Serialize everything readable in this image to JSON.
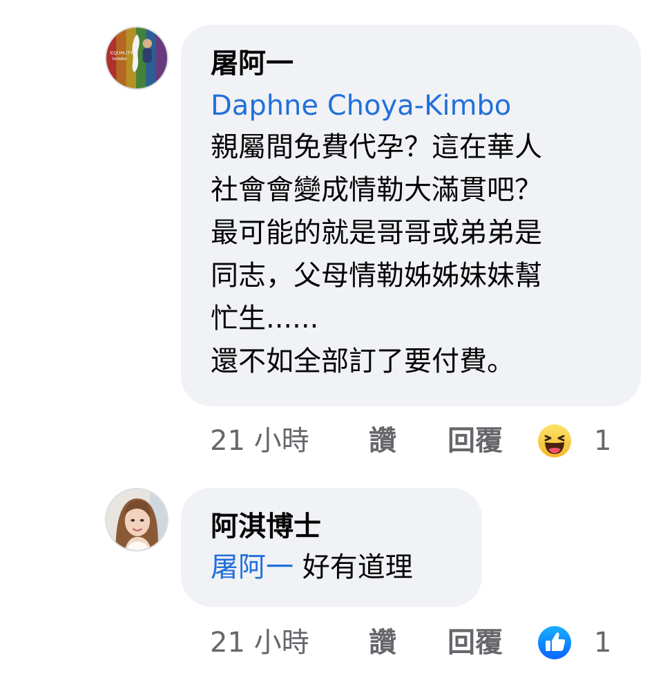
{
  "comments": [
    {
      "author": "屠阿一",
      "mention": "Daphne Choya-Kimbo",
      "lines": [
        "親屬間免費代孕？這在華人",
        "社會會變成情勒大滿貫吧？",
        "最可能的就是哥哥或弟弟是",
        "同志，父母情勒姊姊妹妹幫",
        "忙生......",
        "還不如全部訂了要付費。"
      ],
      "avatar_text": [
        "EQUALITY",
        "TAIWAN"
      ],
      "time": "21 小時",
      "like_label": "讚",
      "reply_label": "回覆",
      "reaction_icon": "haha-emoji-icon",
      "reaction_count": "1"
    },
    {
      "author": "阿淇博士",
      "mention": "屠阿一",
      "text": " 好有道理",
      "time": "21 小時",
      "like_label": "讚",
      "reply_label": "回覆",
      "reaction_icon": "like-thumb-icon",
      "reaction_count": "1"
    }
  ],
  "colors": {
    "bubble": "#f0f2f5",
    "mention": "#216fdb",
    "meta": "#65676b",
    "like_blue": "#1877f2",
    "haha_yellow": "#f7c23b"
  }
}
